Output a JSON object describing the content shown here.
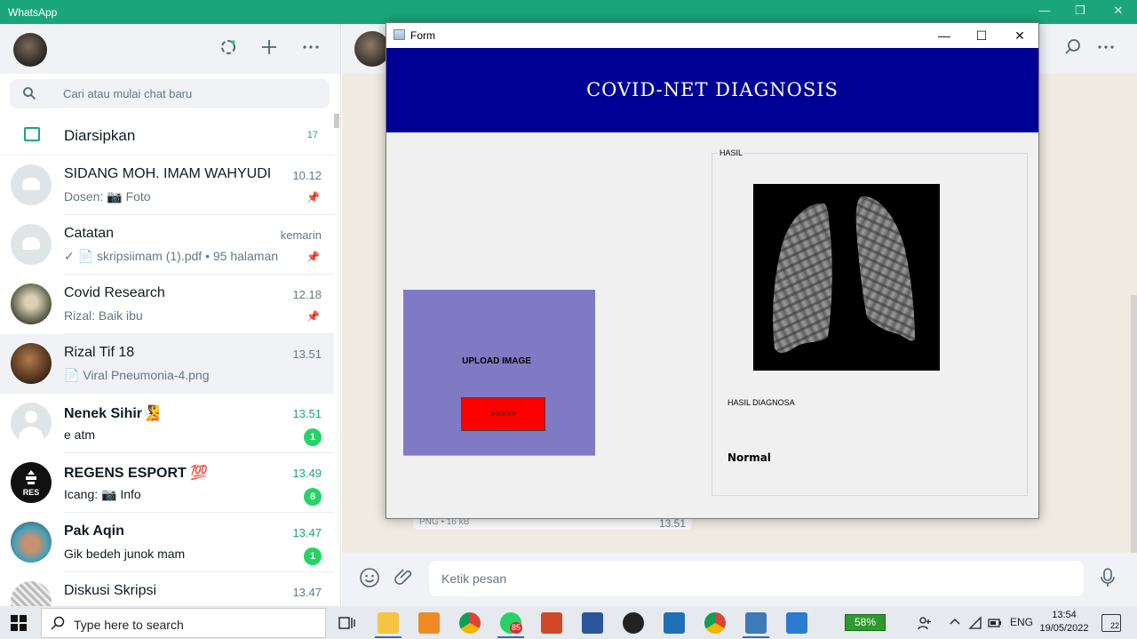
{
  "whatsapp": {
    "title": "WhatsApp",
    "window_controls": [
      "—",
      "❐",
      "✕"
    ],
    "search": {
      "placeholder": "Cari atau mulai chat baru"
    },
    "archived": {
      "label": "Diarsipkan",
      "count": "17"
    },
    "chats": [
      {
        "name": "SIDANG MOH. IMAM WAHYUDI",
        "time": "10.12",
        "message": "Dosen: 📷 Foto",
        "pinned": true,
        "unread": ""
      },
      {
        "name": "Catatan",
        "time": "kemarin",
        "message": "✓ 📄 skripsiimam (1).pdf • 95 halaman",
        "pinned": true,
        "unread": ""
      },
      {
        "name": "Covid Research",
        "time": "12.18",
        "message": "Rizal: Baik ibu",
        "pinned": true,
        "unread": ""
      },
      {
        "name": "Rizal Tif 18",
        "time": "13.51",
        "message": "📄 Viral Pneumonia-4.png",
        "pinned": false,
        "unread": ""
      },
      {
        "name": "Nenek Sihir🧏",
        "time": "13.51",
        "message": "e atm",
        "pinned": false,
        "unread": "1"
      },
      {
        "name": "REGENS ESPORT 💯",
        "time": "13.49",
        "message": "Icang: 📷 Info",
        "pinned": false,
        "unread": "8"
      },
      {
        "name": "Pak Aqin",
        "time": "13.47",
        "message": "Gik bedeh junok mam",
        "pinned": false,
        "unread": "1"
      },
      {
        "name": "Diskusi Skripsi",
        "time": "13.47",
        "message": "",
        "pinned": false,
        "unread": ""
      }
    ],
    "attachment_info": "PNG • 16 kB",
    "attachment_time": "13.51",
    "compose": {
      "placeholder": "Ketik pesan"
    }
  },
  "form_window": {
    "title": "Form",
    "banner_title": "COVID-NET DIAGNOSIS",
    "upload_label": "UPLOAD IMAGE",
    "upload_button": ">>>>>",
    "result_group_label": "HASIL",
    "diagnosis_label": "HASIL DIAGNOSA",
    "diagnosis_value": "Normal"
  },
  "taskbar": {
    "search_placeholder": "Type here to search",
    "whatsapp_badge": "85",
    "battery": "58%",
    "language": "ENG",
    "time": "13:54",
    "date": "19/05/2022",
    "notifications": "22"
  },
  "colors": {
    "whatsapp_green": "#1ba67a",
    "banner": "#000094",
    "upload_panel": "#8079c3",
    "upload_button": "#ff0000",
    "unread_badge": "#25d366"
  }
}
